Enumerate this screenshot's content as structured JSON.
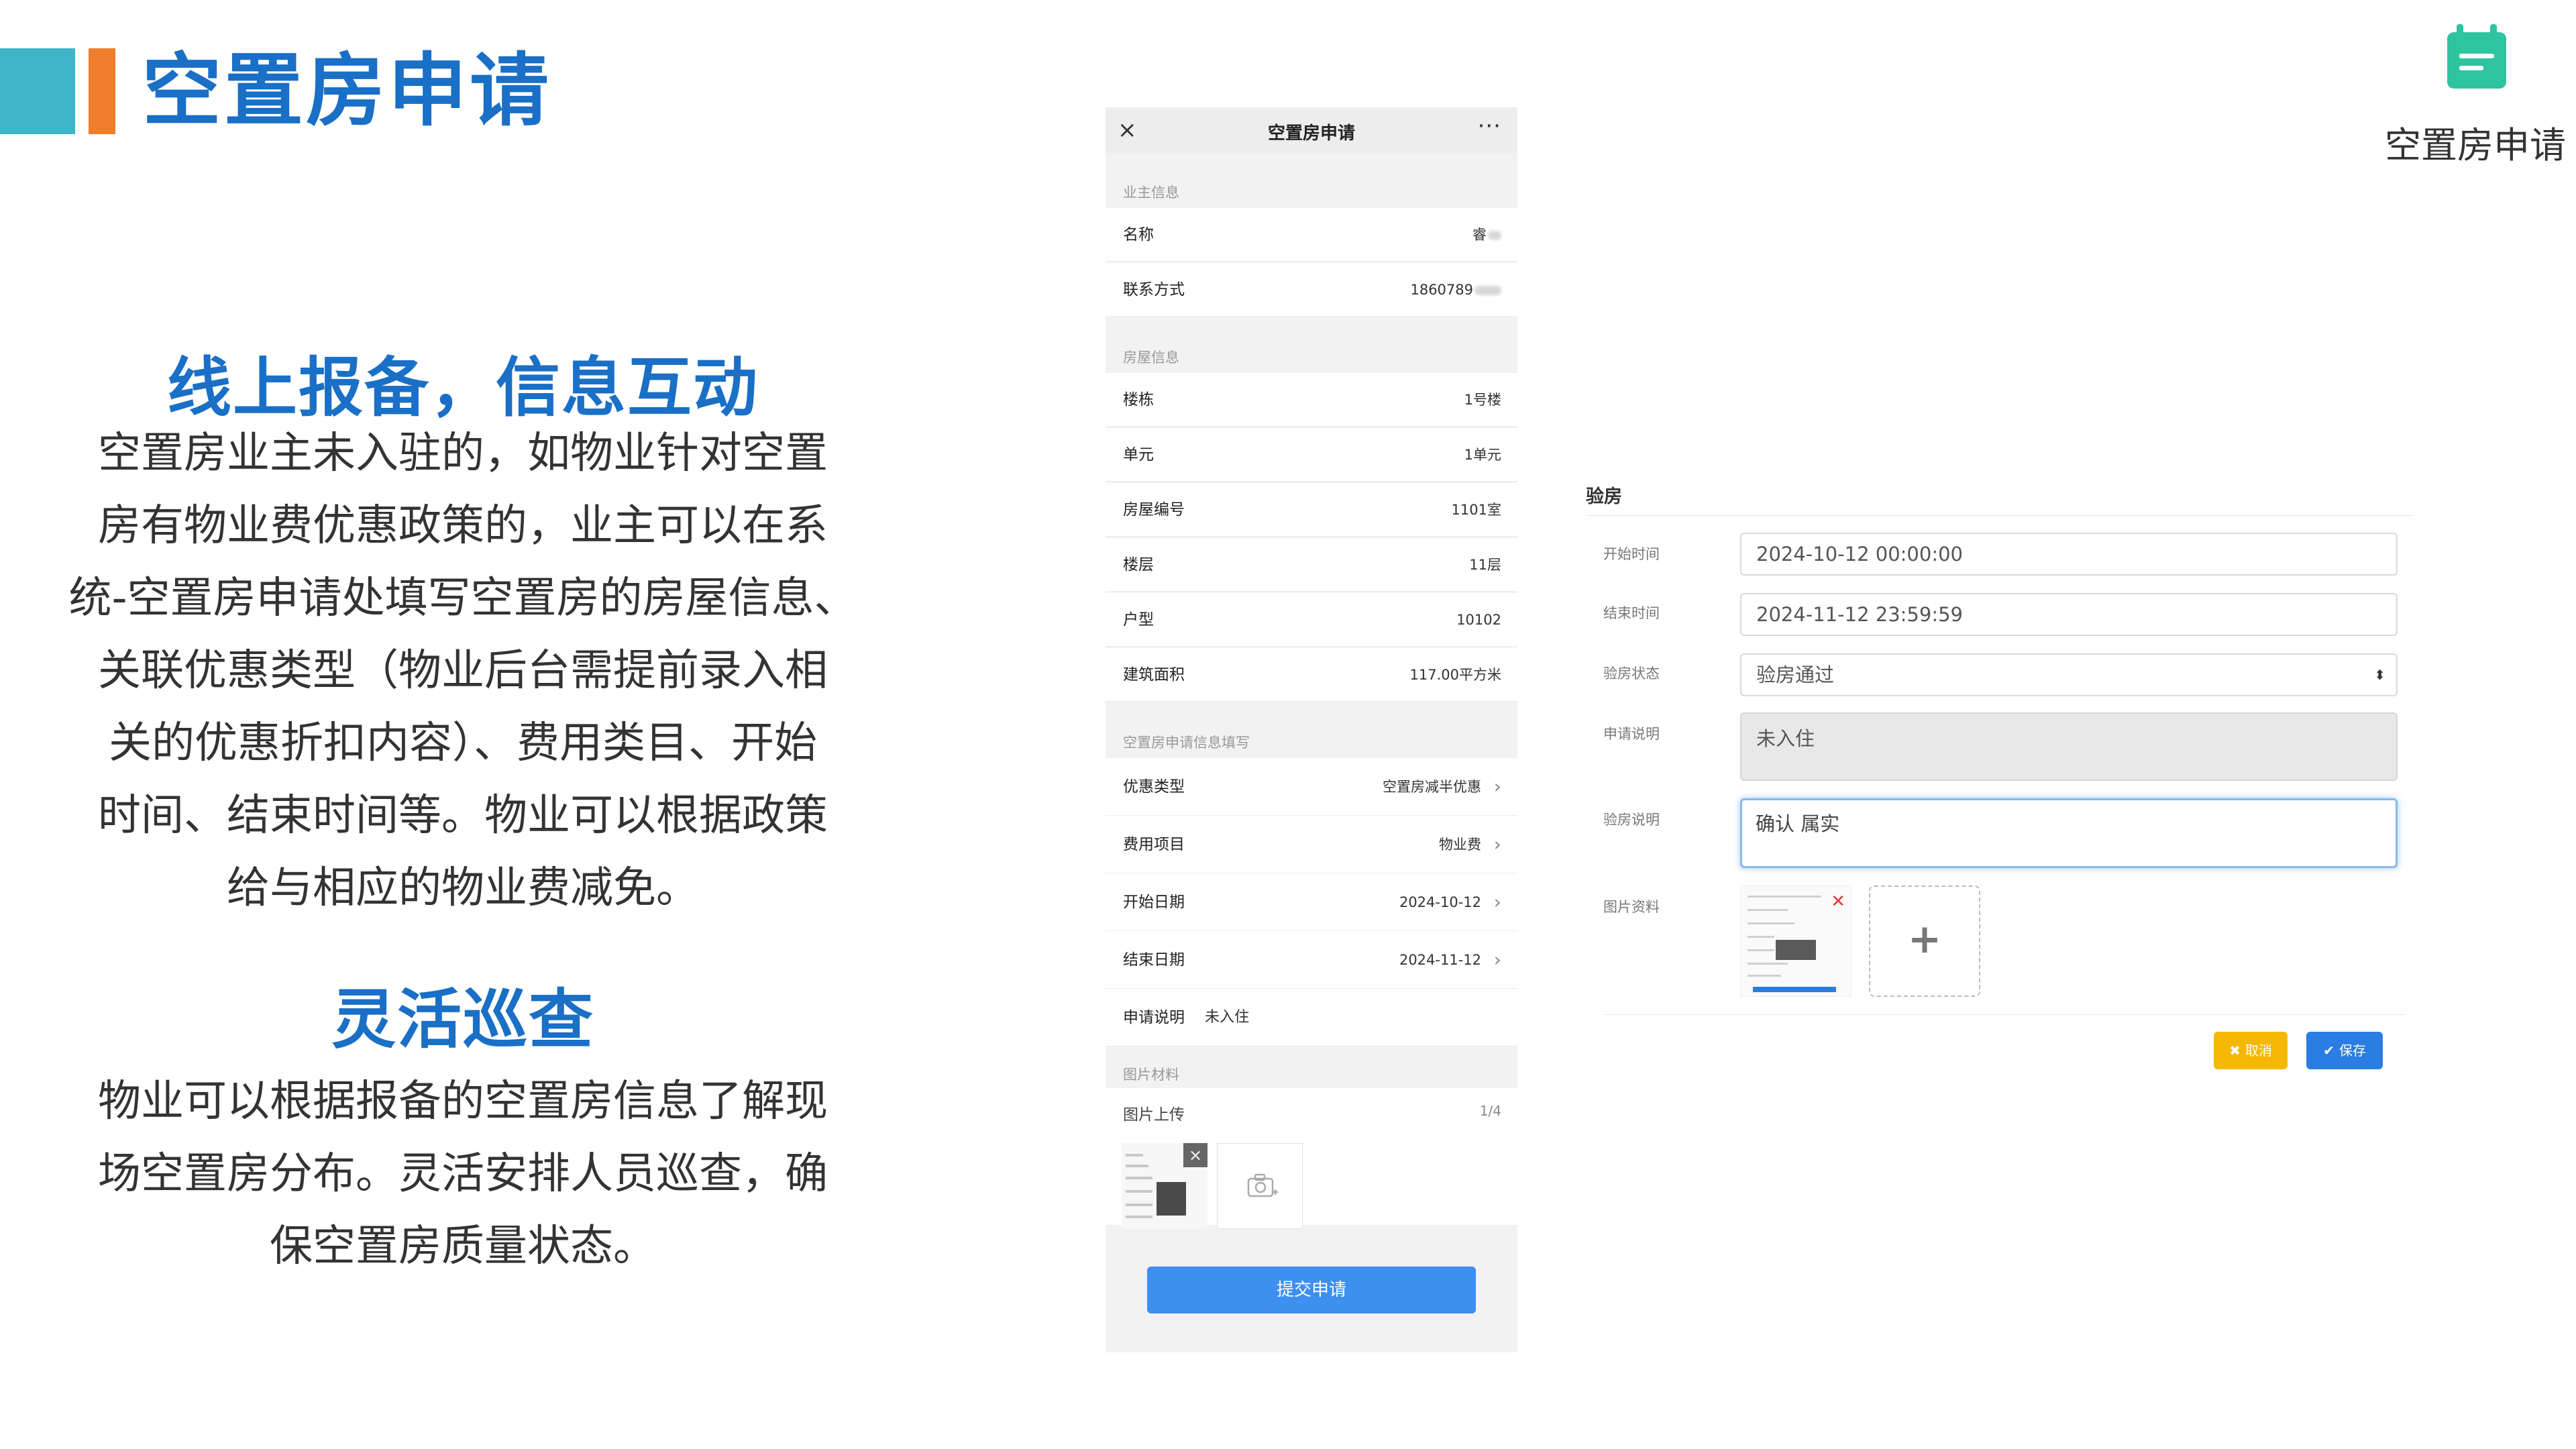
{
  "slide": {
    "title": "空置房申请",
    "icon_label": "空置房申请",
    "section1_heading": "线上报备，信息互动",
    "section1_lines": [
      "空置房业主未入驻的，如物业针对空置",
      "房有物业费优惠政策的，业主可以在系",
      "统-空置房申请处填写空置房的房屋信息、",
      "关联优惠类型（物业后台需提前录入相",
      "关的优惠折扣内容）、费用类目、开始",
      "时间、结束时间等。物业可以根据政策",
      "给与相应的物业费减免。"
    ],
    "section2_heading": "灵活巡查",
    "section2_lines": [
      "物业可以根据报备的空置房信息了解现",
      "场空置房分布。灵活安排人员巡查，确",
      "保空置房质量状态。"
    ],
    "colors": {
      "accent_blue": "#1a6fc6",
      "bar_teal": "#3db6c8",
      "bar_orange": "#ef7d2b",
      "icon_green": "#2ec4a0"
    }
  },
  "mobile": {
    "header_title": "空置房申请",
    "close_glyph": "×",
    "more_glyph": "···",
    "owner_section": "业主信息",
    "name_label": "名称",
    "name_value": "睿",
    "phone_label": "联系方式",
    "phone_value": "1860789",
    "house_section": "房屋信息",
    "building_label": "楼栋",
    "building_value": "1号楼",
    "unit_label": "单元",
    "unit_value": "1单元",
    "room_label": "房屋编号",
    "room_value": "1101室",
    "floor_label": "楼层",
    "floor_value": "11层",
    "type_label": "户型",
    "type_value": "10102",
    "area_label": "建筑面积",
    "area_value": "117.00平方米",
    "fill_section": "空置房申请信息填写",
    "discount_label": "优惠类型",
    "discount_value": "空置房减半优惠",
    "fee_label": "费用项目",
    "fee_value": "物业费",
    "start_label": "开始日期",
    "start_value": "2024-10-12",
    "end_label": "结束日期",
    "end_value": "2024-11-12",
    "desc_label": "申请说明",
    "desc_value": "未入住",
    "photo_section": "图片材料",
    "upload_label": "图片上传",
    "upload_count": "1/4",
    "submit_label": "提交申请"
  },
  "web": {
    "title": "验房",
    "start_time_label": "开始时间",
    "start_time_value": "2024-10-12 00:00:00",
    "end_time_label": "结束时间",
    "end_time_value": "2024-11-12 23:59:59",
    "status_label": "验房状态",
    "status_value": "验房通过",
    "apply_desc_label": "申请说明",
    "apply_desc_value": "未入住",
    "inspect_desc_label": "验房说明",
    "inspect_desc_value": "确认 属实",
    "photos_label": "图片资料",
    "cancel_label": "取消",
    "save_label": "保存",
    "cancel_color": "#f5b800",
    "save_color": "#2a7de1"
  }
}
